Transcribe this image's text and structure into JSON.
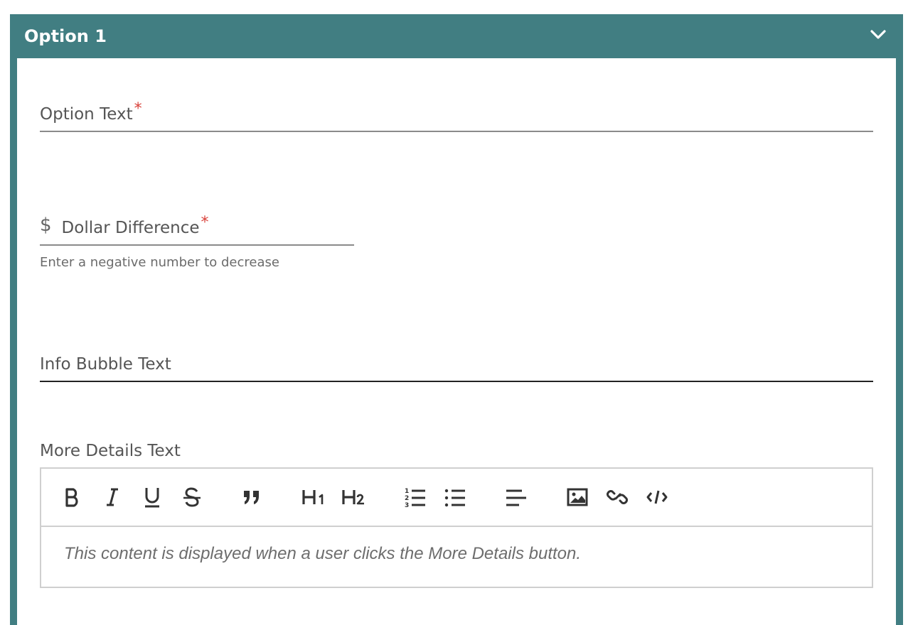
{
  "panel": {
    "title": "Option 1",
    "header_color": "#417e82",
    "toggle_icon": "chevron-down-icon"
  },
  "fields": {
    "option_text": {
      "label": "Option Text",
      "required_mark": "*"
    },
    "dollar_difference": {
      "prefix": "$",
      "label": "Dollar Difference",
      "required_mark": "*",
      "helper": "Enter a negative number to decrease"
    },
    "info_bubble": {
      "label": "Info Bubble Text"
    }
  },
  "more_details": {
    "label": "More Details Text",
    "toolbar": [
      "bold-icon",
      "italic-icon",
      "underline-icon",
      "strikethrough-icon",
      "blockquote-icon",
      "heading-1-icon",
      "heading-2-icon",
      "ordered-list-icon",
      "bullet-list-icon",
      "align-left-icon",
      "image-icon",
      "link-icon",
      "code-icon"
    ],
    "content": "This content is displayed when a user clicks the More Details button."
  },
  "colors": {
    "required": "#d9413a",
    "border": "#cfcfcf"
  }
}
